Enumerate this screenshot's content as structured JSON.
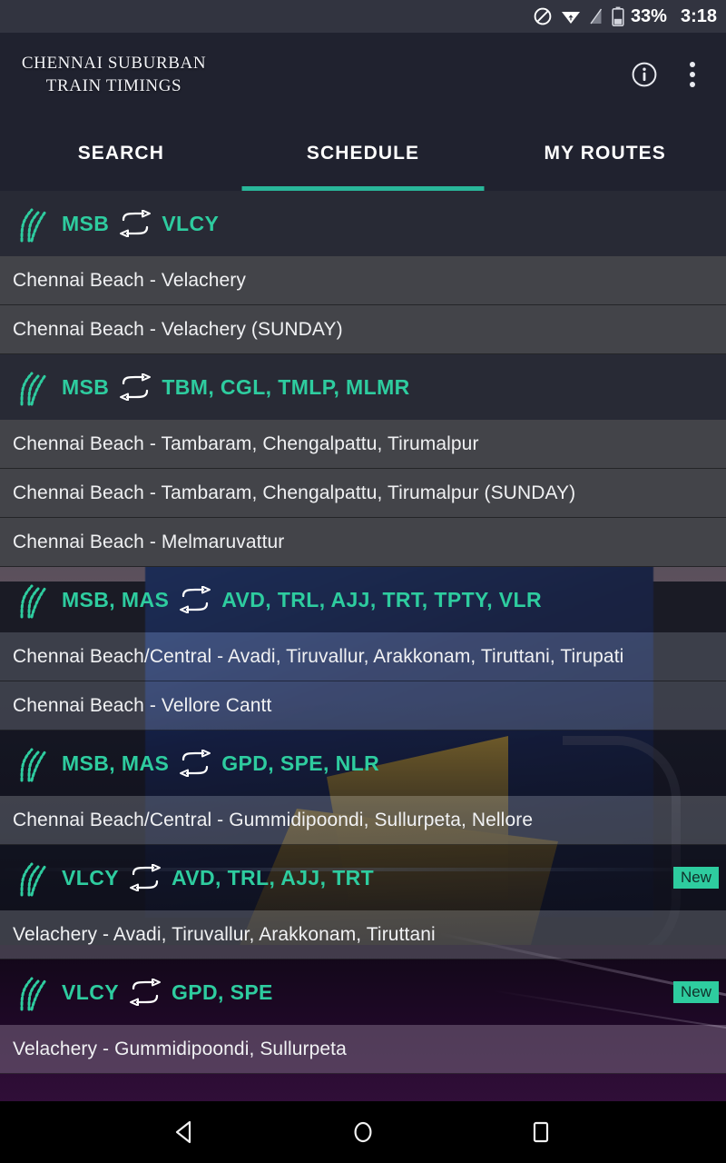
{
  "status_bar": {
    "icons": [
      "do-not-disturb-icon",
      "wifi-icon",
      "signal-off-icon",
      "battery-icon"
    ],
    "battery_percent": "33%",
    "clock": "3:18"
  },
  "app_bar": {
    "brand_title": "CHENNAI SUBURBAN\nTRAIN TIMINGS",
    "info_label": "info-icon",
    "overflow_label": "more-options-icon"
  },
  "tabs": [
    {
      "label": "SEARCH",
      "active": false
    },
    {
      "label": "SCHEDULE",
      "active": true
    },
    {
      "label": "MY ROUTES",
      "active": false
    }
  ],
  "colors": {
    "accent": "#2ecc9f",
    "tab_indicator": "#29b79a",
    "app_bar_bg": "#20222f",
    "group_header_bg": "#282a35",
    "row_bg": "#434449",
    "badge_bg": "#2ecc9f",
    "status_bar_bg": "#323440",
    "nav_bar_bg": "#000000"
  },
  "groups": [
    {
      "from": "MSB",
      "to": "VLCY",
      "badge": null,
      "routes": [
        "Chennai Beach - Velachery",
        "Chennai Beach - Velachery (SUNDAY)"
      ]
    },
    {
      "from": "MSB",
      "to": "TBM, CGL, TMLP, MLMR",
      "badge": null,
      "routes": [
        "Chennai Beach - Tambaram, Chengalpattu, Tirumalpur",
        "Chennai Beach - Tambaram, Chengalpattu, Tirumalpur (SUNDAY)",
        "Chennai Beach - Melmaruvattur"
      ]
    },
    {
      "from": "MSB, MAS",
      "to": "AVD, TRL, AJJ, TRT, TPTY, VLR",
      "badge": null,
      "routes": [
        "Chennai Beach/Central - Avadi, Tiruvallur, Arakkonam, Tiruttani, Tirupati",
        "Chennai Beach - Vellore Cantt"
      ]
    },
    {
      "from": "MSB, MAS",
      "to": "GPD, SPE, NLR",
      "badge": null,
      "routes": [
        "Chennai Beach/Central - Gummidipoondi, Sullurpeta, Nellore"
      ]
    },
    {
      "from": "VLCY",
      "to": "AVD, TRL, AJJ, TRT",
      "badge": "New",
      "routes": [
        "Velachery - Avadi, Tiruvallur, Arakkonam, Tiruttani"
      ]
    },
    {
      "from": "VLCY",
      "to": "GPD, SPE",
      "badge": "New",
      "routes": [
        "Velachery - Gummidipoondi, Sullurpeta"
      ]
    }
  ],
  "nav_bar": {
    "back": "back-triangle-icon",
    "home": "home-circle-icon",
    "recents": "recents-square-icon"
  }
}
